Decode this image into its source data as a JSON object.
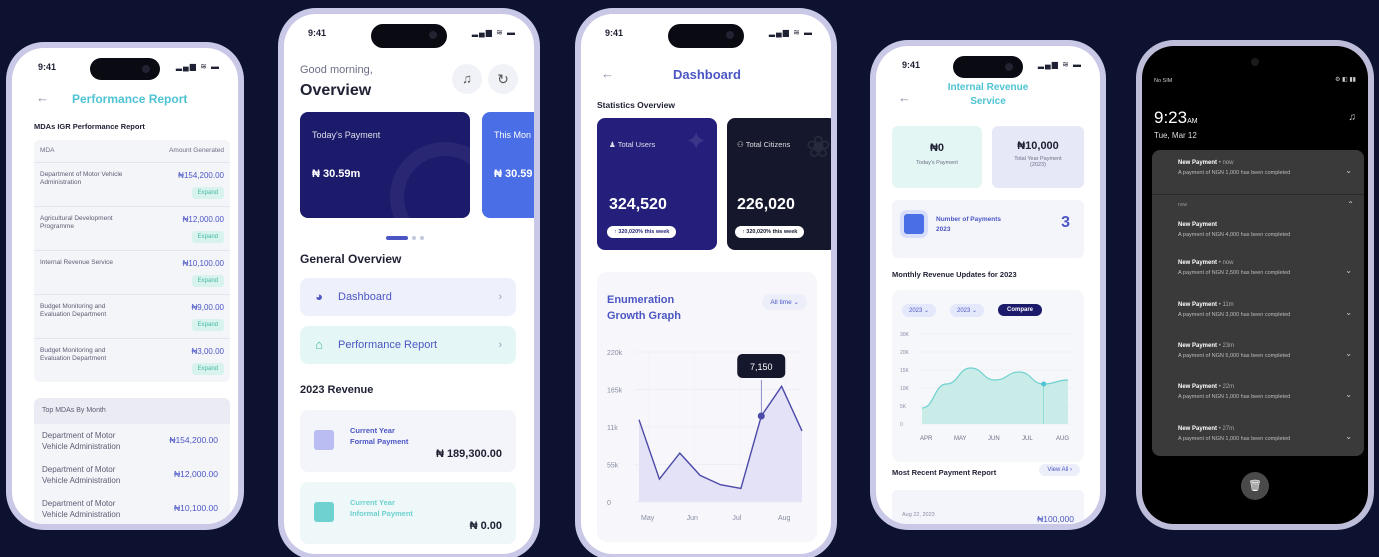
{
  "phone1": {
    "time": "9:41",
    "title": "Performance Report",
    "section_title": "MDAs IGR Performance Report",
    "col_mda": "MDA",
    "col_amount": "Amount Generated",
    "rows": [
      {
        "name": "Department of Motor Vehicle Administration",
        "amount": "₦154,200.00",
        "action": "Expand"
      },
      {
        "name": "Agricultural Development Programme",
        "amount": "₦12,000.00",
        "action": "Expand"
      },
      {
        "name": "Internal Revenue Service",
        "amount": "₦10,100.00",
        "action": "Expand"
      },
      {
        "name": "Budget Monitoring and Evaluation Department",
        "amount": "₦9,00.00",
        "action": "Expand"
      },
      {
        "name": "Budget Monitoring and Evaluation Department",
        "amount": "₦3,00.00",
        "action": "Expand"
      }
    ],
    "top_title": "Top MDAs By Month",
    "top_rows": [
      {
        "name": "Department of Motor Vehicle Administration",
        "amount": "₦154,200.00"
      },
      {
        "name": "Department of Motor Vehicle Administration",
        "amount": "₦12,000.00"
      },
      {
        "name": "Department of Motor Vehicle Administration",
        "amount": "₦10,100.00"
      }
    ]
  },
  "phone2": {
    "time": "9:41",
    "greeting": "Good morning,",
    "title": "Overview",
    "payment_label": "Today's Payment",
    "payment_value": "₦ 30.59m",
    "payment2_label": "This Mon",
    "payment2_value": "₦ 30.59",
    "general_title": "General Overview",
    "nav": [
      "Dashboard",
      "Performance Report"
    ],
    "revenue_title": "2023 Revenue",
    "rev1_label_1": "Current Year",
    "rev1_label_2": "Formal Payment",
    "rev1_value": "₦ 189,300.00",
    "rev2_label_1": "Current Year",
    "rev2_label_2": "Informal Payment",
    "rev2_value": "₦ 0.00"
  },
  "phone3": {
    "time": "9:41",
    "title": "Dashboard",
    "stats_title": "Statistics Overview",
    "total_users_label": "Total Users",
    "total_users_value": "324,520",
    "total_users_badge": "↑ 320,020% this week",
    "total_citizens_label": "Total Citizens",
    "total_citizens_value": "226,020",
    "total_citizens_badge": "↑ 320,020% this week",
    "graph_title_1": "Enumeration",
    "graph_title_2": "Growth Graph",
    "filter": "All time",
    "tooltip": "7,150"
  },
  "phone4": {
    "time": "9:41",
    "title_1": "Internal Revenue",
    "title_2": "Service",
    "today_value": "₦0",
    "today_label": "Today's Payment",
    "total_value": "₦10,000",
    "total_label_1": "Total Year Payment",
    "total_label_2": "(2023)",
    "num_label_1": "Number of Payments",
    "num_label_2": "2023",
    "num_value": "3",
    "monthly_title": "Monthly Revenue Updates for 2023",
    "filter_1": "2023",
    "filter_2": "2023",
    "compare": "Compare",
    "recent_title": "Most Recent Payment Report",
    "view_all": "View All",
    "recent_date": "Aug 22, 2023",
    "recent_amount": "₦100,000"
  },
  "phone5": {
    "carrier": "No SIM",
    "time": "9:23",
    "ampm": "AM",
    "date": "Tue, Mar 12",
    "notifications": [
      {
        "title": "New Payment",
        "ago": "• now",
        "desc": "A payment of NGN 1,000 has been completed"
      },
      {
        "title": "New Payment",
        "ago": "",
        "desc": "A payment of NGN 4,000 has been completed"
      },
      {
        "title": "New Payment",
        "ago": "• now",
        "desc": "A payment of NGN 2,500 has been completed"
      },
      {
        "title": "New Payment",
        "ago": "• 11m",
        "desc": "A payment of NGN 3,000 has been completed"
      },
      {
        "title": "New Payment",
        "ago": "• 23m",
        "desc": "A payment of NGN 5,000 has been completed"
      },
      {
        "title": "New Payment",
        "ago": "• 22m",
        "desc": "A payment of NGN 1,000 has been completed"
      },
      {
        "title": "New Payment",
        "ago": "• 27m",
        "desc": "A payment of NGN 1,000 has been completed"
      }
    ],
    "header_now": "now"
  },
  "chart_data": [
    {
      "type": "area",
      "x": [
        "May",
        "Jun",
        "Jul",
        "Aug"
      ],
      "y_ticks": [
        "220k",
        "165k",
        "11k",
        "55k",
        "0"
      ],
      "series": [
        {
          "values": [
            40,
            8,
            22,
            10,
            5,
            3,
            42,
            58,
            34
          ]
        }
      ],
      "annotation": "7,150",
      "grid": true
    },
    {
      "type": "area",
      "x": [
        "APR",
        "MAY",
        "JUN",
        "JUL",
        "AUG"
      ],
      "y_ticks": [
        "30K",
        "20K",
        "15K",
        "10K",
        "5K",
        "0"
      ],
      "series": [
        {
          "values": [
            0.2,
            0.5,
            0.7,
            0.55,
            0.65,
            0.5,
            0.55
          ]
        }
      ],
      "grid": true
    }
  ]
}
